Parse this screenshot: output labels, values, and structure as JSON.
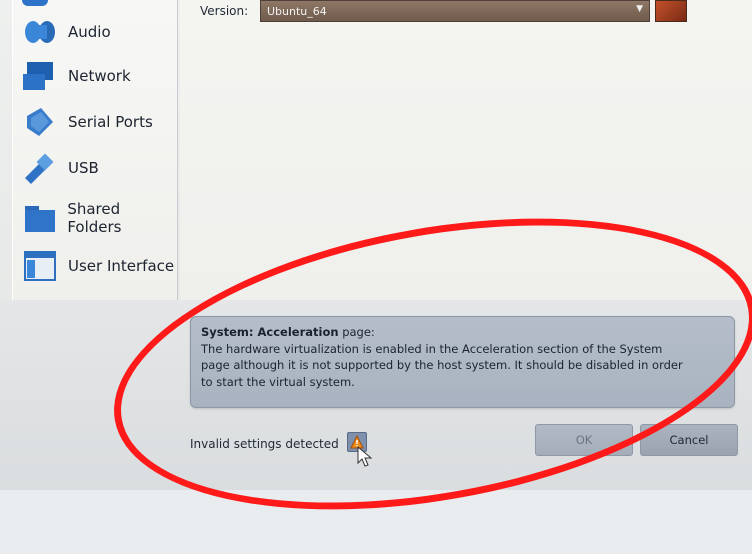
{
  "header": {
    "version_label": "Version:",
    "version_value": "Ubuntu_64"
  },
  "sidebar": {
    "items": [
      {
        "label": "Audio",
        "icon": "audio-icon"
      },
      {
        "label": "Network",
        "icon": "network-icon"
      },
      {
        "label": "Serial Ports",
        "icon": "serial-ports-icon"
      },
      {
        "label": "USB",
        "icon": "usb-icon"
      },
      {
        "label": "Shared Folders",
        "icon": "shared-folders-icon"
      },
      {
        "label": "User Interface",
        "icon": "user-interface-icon"
      }
    ]
  },
  "warning": {
    "title": "System: Acceleration",
    "title_suffix": "page:",
    "line1": "The hardware virtualization is enabled in the Acceleration section of the System",
    "line2": "page although it is not supported by the host system. It should be disabled in order",
    "line3": "to start the virtual system."
  },
  "footer": {
    "status_text": "Invalid settings detected",
    "ok_label": "OK",
    "cancel_label": "Cancel"
  },
  "colors": {
    "highlight": "#ff1a1a",
    "warning_bg": "#b0b9c6"
  }
}
